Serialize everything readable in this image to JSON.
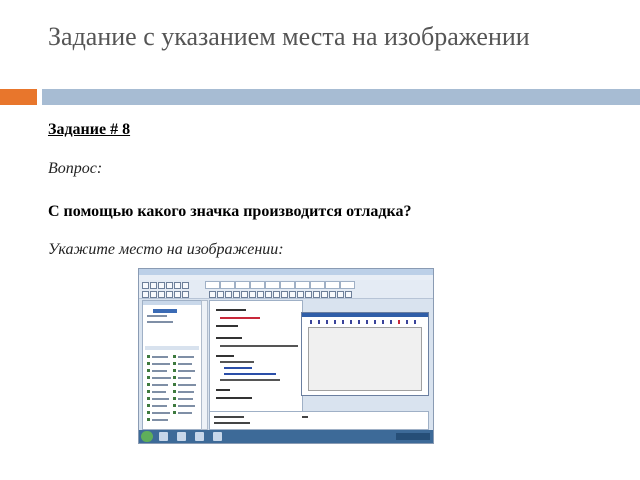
{
  "slide": {
    "title": "Задание с указанием места на изображении",
    "task_heading": "Задание # 8",
    "question_label": "Вопрос:",
    "question_text": "С помощью какого значка производится отладка?",
    "instruction": "Укажите место на изображении:"
  },
  "colors": {
    "accent_orange": "#e8762c",
    "divider_blue": "#a7bcd3",
    "title_gray": "#555555"
  },
  "screenshot": {
    "icons": [
      "toolbar-button-icon",
      "windows-start-icon",
      "taskbar-app-icon"
    ]
  }
}
